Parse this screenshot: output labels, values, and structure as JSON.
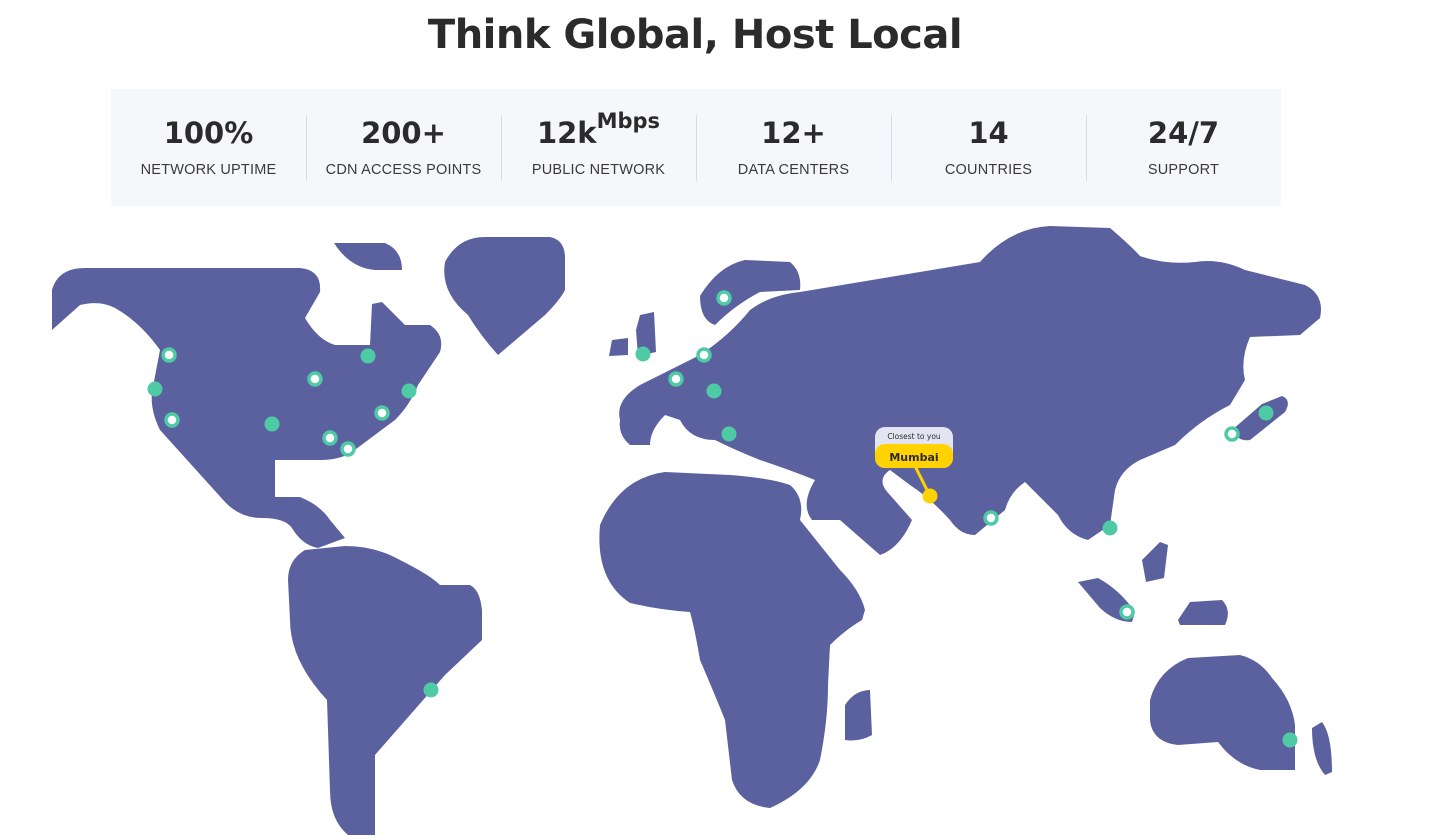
{
  "headline": "Think Global, Host Local",
  "stats": [
    {
      "value": "100%",
      "sup": "",
      "label": "NETWORK UPTIME"
    },
    {
      "value": "200+",
      "sup": "",
      "label": "CDN ACCESS POINTS"
    },
    {
      "value": "12k",
      "sup": "Mbps",
      "label": "PUBLIC NETWORK"
    },
    {
      "value": "12+",
      "sup": "",
      "label": "DATA CENTERS"
    },
    {
      "value": "14",
      "sup": "",
      "label": "COUNTRIES"
    },
    {
      "value": "24/7",
      "sup": "",
      "label": "SUPPORT"
    }
  ],
  "map": {
    "land_color": "#5b619e",
    "dot_color": "#4ecba5",
    "highlight_color": "#ffd200",
    "tooltip": {
      "caption": "Closest to you",
      "city": "Mumbai"
    }
  }
}
